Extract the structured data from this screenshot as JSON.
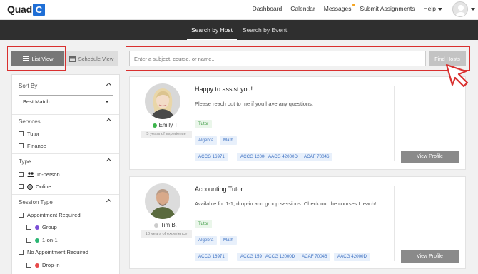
{
  "logo": {
    "text": "Quad",
    "box_letter": "C"
  },
  "nav": {
    "links": [
      "Dashboard",
      "Calendar",
      "Messages",
      "Submit Assignments",
      "Help"
    ]
  },
  "tabs": [
    {
      "label": "Search by Host",
      "active": true
    },
    {
      "label": "Search by Event",
      "active": false
    }
  ],
  "view_toggle": {
    "list_label": "List View",
    "schedule_label": "Schedule View"
  },
  "search": {
    "placeholder": "Enter a subject, course, or name...",
    "button_label": "Find Hosts"
  },
  "sidebar": {
    "sort": {
      "heading": "Sort By",
      "selected": "Best Match"
    },
    "services": {
      "heading": "Services",
      "items": [
        "Tutor",
        "Finance"
      ]
    },
    "type": {
      "heading": "Type",
      "items": [
        "In-person",
        "Online"
      ]
    },
    "session_type": {
      "heading": "Session Type",
      "appointment_required": "Appointment Required",
      "group": "Group",
      "one_on_one": "1-on-1",
      "no_appointment_required": "No Appointment Required",
      "drop_in": "Drop-in"
    }
  },
  "hosts": [
    {
      "name": "Emily T.",
      "status": "online",
      "experience": "5 years of experience",
      "title": "Happy to assist you!",
      "description": "Please reach out to me if you have any questions.",
      "service_tags": [
        "Tutor"
      ],
      "subject_tags": [
        "Algebra",
        "Math"
      ],
      "course_tags": [
        "ACCG 16971",
        "ACCG 12000D",
        "AACG 42000D",
        "ACAF 70046"
      ],
      "button_label": "View Profile"
    },
    {
      "name": "Tim B.",
      "status": "offline",
      "experience": "10 years of experience",
      "title": "Accounting Tutor",
      "description": "Available for 1-1, drop-in and group sessions. Check out the courses I teach!",
      "service_tags": [
        "Tutor"
      ],
      "subject_tags": [
        "Algebra",
        "Math"
      ],
      "course_tags": [
        "ACCG 16971",
        "ACCG 15910",
        "ACCG 12000D",
        "ACAF 70046",
        "AACG 42000D"
      ],
      "button_label": "View Profile"
    }
  ],
  "colors": {
    "brand": "#1f6fd6",
    "highlight": "#d9302f",
    "online": "#3cb44b",
    "offline": "#cccccc",
    "group": "#7b4fd6",
    "one_on_one": "#2bb673",
    "drop_in": "#e84a4a",
    "notification": "#f6a623"
  }
}
